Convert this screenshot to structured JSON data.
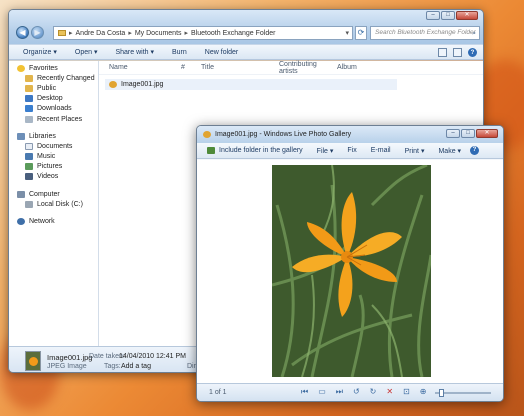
{
  "explorer": {
    "breadcrumb": [
      "Andre Da Costa",
      "My Documents",
      "Bluetooth Exchange Folder"
    ],
    "search_placeholder": "Search Bluetooth Exchange Folder",
    "toolbar": [
      "Organize ▾",
      "Open ▾",
      "Share with ▾",
      "Burn",
      "New folder"
    ],
    "favorites_label": "Favorites",
    "favorites": [
      "Recently Changed",
      "Public",
      "Desktop",
      "Downloads",
      "Recent Places"
    ],
    "libraries_label": "Libraries",
    "libraries": [
      "Documents",
      "Music",
      "Pictures",
      "Videos"
    ],
    "computer_label": "Computer",
    "computer": [
      "Local Disk (C:)"
    ],
    "network_label": "Network",
    "columns": [
      "Name",
      "#",
      "Title",
      "Contributing artists",
      "Album"
    ],
    "file_name": "Image001.jpg",
    "details": {
      "filename": "Image001.jpg",
      "date_label": "Date taken:",
      "date_value": "14/04/2010 12:41 PM",
      "type": "JPEG Image",
      "tags_label": "Tags:",
      "tags_value": "Add a tag",
      "dims_label": "Dime"
    }
  },
  "gallery": {
    "title": "Image001.jpg - Windows Live Photo Gallery",
    "toolbar": [
      "Include folder in the gallery",
      "File ▾",
      "Fix",
      "E-mail",
      "Print ▾",
      "Make ▾",
      "»"
    ],
    "page_indicator": "1 of 1"
  }
}
